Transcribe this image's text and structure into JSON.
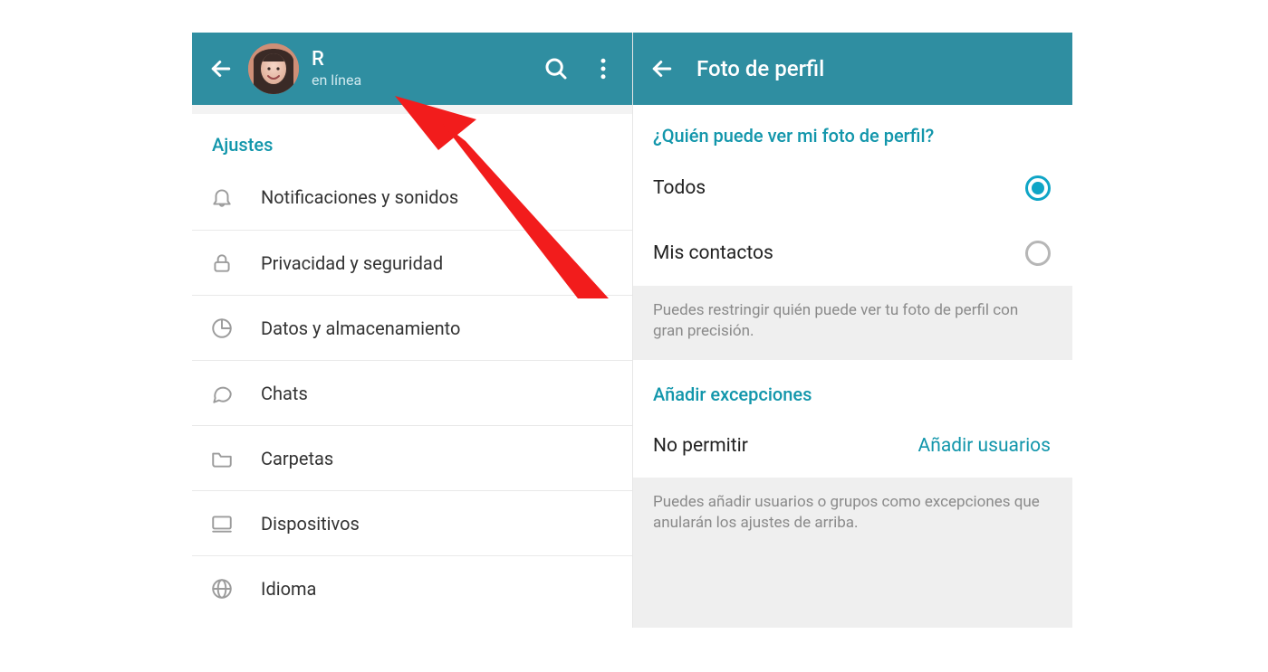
{
  "colors": {
    "accentBar": "#2f8ea1",
    "accentText": "#1296ab",
    "annotation": "#f21c1c"
  },
  "left": {
    "user": {
      "name": "R",
      "status": "en línea"
    },
    "settingsHeader": "Ajustes",
    "items": [
      {
        "icon": "bell-icon",
        "label": "Notificaciones y sonidos"
      },
      {
        "icon": "lock-icon",
        "label": "Privacidad y seguridad"
      },
      {
        "icon": "data-icon",
        "label": "Datos y almacenamiento"
      },
      {
        "icon": "chat-icon",
        "label": "Chats"
      },
      {
        "icon": "folder-icon",
        "label": "Carpetas"
      },
      {
        "icon": "devices-icon",
        "label": "Dispositivos"
      },
      {
        "icon": "globe-icon",
        "label": "Idioma"
      }
    ]
  },
  "right": {
    "title": "Foto de perfil",
    "question": "¿Quién puede ver mi foto de perfil?",
    "options": [
      "Todos",
      "Mis contactos"
    ],
    "selectedOption": 0,
    "hint1": "Puedes restringir quién puede ver tu foto de perfil con gran precisión.",
    "exceptionsHeader": "Añadir excepciones",
    "noPermit": "No permitir",
    "addUsers": "Añadir usuarios",
    "hint2": "Puedes añadir usuarios o grupos como excepciones que anularán los ajustes de arriba."
  }
}
